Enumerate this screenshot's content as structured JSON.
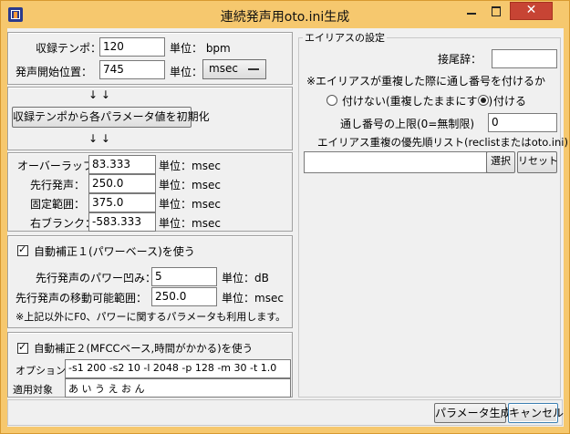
{
  "window": {
    "title": "連続発声用oto.ini生成",
    "close_label": "✕"
  },
  "recording": {
    "tempo_label": "収録テンポ：",
    "tempo_value": "120",
    "tempo_unit": "単位： bpm",
    "start_label": "発声開始位置：",
    "start_value": "745",
    "start_unit_label": "単位：",
    "start_unit_value": "msec"
  },
  "init": {
    "arrows": "↓ ↓",
    "button_label": "収録テンポから各パラメータ値を初期化"
  },
  "params": {
    "overlap_label": "オーバーラップ：",
    "overlap_value": "83.333",
    "overlap_unit": "単位：msec",
    "preutter_label": "先行発声：",
    "preutter_value": "250.0",
    "preutter_unit": "単位：msec",
    "fixed_label": "固定範囲：",
    "fixed_value": "375.0",
    "fixed_unit": "単位：msec",
    "blank_label": "右ブランク：",
    "blank_value": "-583.333",
    "blank_unit": "単位：msec"
  },
  "auto1": {
    "checkbox_label": "自動補正１(パワーベース)を使う",
    "dip_label": "先行発声のパワー凹み：",
    "dip_value": "5",
    "dip_unit": "単位：dB",
    "range_label": "先行発声の移動可能範囲：",
    "range_value": "250.0",
    "range_unit": "単位：msec",
    "note": "※上記以外にF0、パワーに関するパラメータも利用します。"
  },
  "auto2": {
    "checkbox_label": "自動補正２(MFCCベース,時間がかかる)を使う",
    "option_label": "オプション",
    "option_value": "-s1 200 -s2 10 -l 2048 -p 128 -m 30 -t 1.0",
    "target_label": "適用対象",
    "target_value": "あ い う え お ん"
  },
  "alias": {
    "legend": "エイリアスの設定",
    "suffix_label": "接尾辞：",
    "suffix_value": "",
    "dup_note": "※エイリアスが重複した際に通し番号を付けるか",
    "radio_no_label": "付けない(重複したままにする)",
    "radio_yes_label": "付ける",
    "max_label": "通し番号の上限(0=無制限)",
    "max_value": "0",
    "priority_label": "エイリアス重複の優先順リスト(reclistまたはoto.ini)：",
    "priority_value": "",
    "select_label": "選択",
    "reset_label": "リセット"
  },
  "footer": {
    "generate_label": "パラメータ生成",
    "cancel_label": "キャンセル"
  }
}
